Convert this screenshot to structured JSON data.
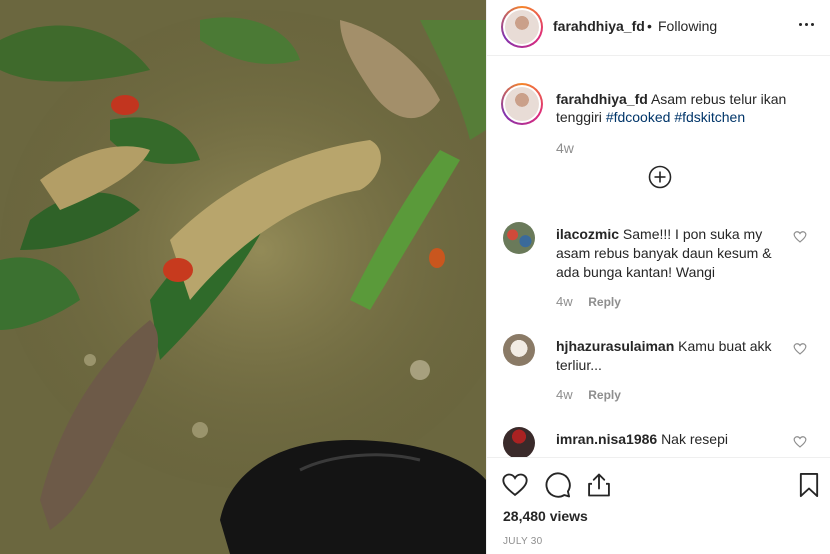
{
  "post": {
    "username": "farahdhiya_fd",
    "separator": "•",
    "follow_status": "Following"
  },
  "caption": {
    "username": "farahdhiya_fd",
    "text": "Asam rebus telur ikan tenggiri",
    "hashtags": [
      "#fdcooked",
      "#fdskitchen"
    ],
    "time": "4w"
  },
  "comments": [
    {
      "username": "ilacozmic",
      "text": "Same!!! I pon suka my asam rebus banyak daun kesum & ada bunga kantan! Wangi",
      "time": "4w",
      "reply": "Reply"
    },
    {
      "username": "hjhazurasulaiman",
      "text": "Kamu buat akk terliur...",
      "time": "4w",
      "reply": "Reply"
    },
    {
      "username": "imran.nisa1986",
      "text": "Nak resepi",
      "time": "",
      "reply": ""
    }
  ],
  "stats": {
    "views": "28,480 views",
    "date": "JULY 30"
  },
  "icons": {
    "more": "more-options-icon",
    "add_comment": "plus-circle-icon",
    "like": "heart-icon",
    "comment": "comment-bubble-icon",
    "share": "share-icon",
    "save": "bookmark-icon"
  }
}
